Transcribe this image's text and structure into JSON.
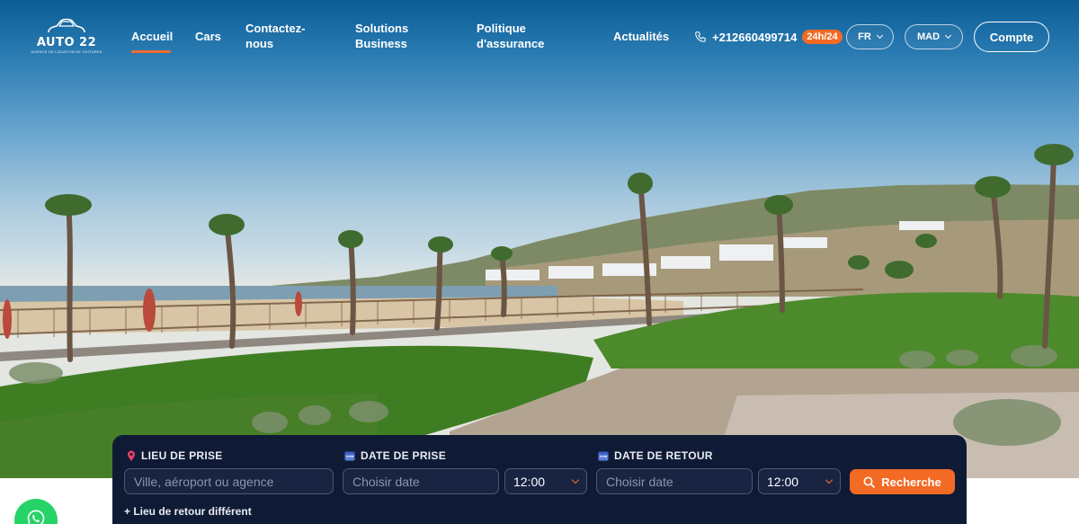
{
  "brand": {
    "name": "AUTO 22",
    "tagline": "AGENCE DE LOCATION DE VOITURES"
  },
  "nav": {
    "items": [
      {
        "label": "Accueil",
        "active": true
      },
      {
        "label": "Cars"
      },
      {
        "label": "Contactez-nous"
      },
      {
        "label": "Solutions Business"
      },
      {
        "label": "Politique d'assurance"
      },
      {
        "label": "Actualités"
      }
    ]
  },
  "contact": {
    "phone": "+212660499714",
    "badge": "24h/24"
  },
  "language": {
    "selected": "FR"
  },
  "currency": {
    "selected": "MAD"
  },
  "account": {
    "label": "Compte"
  },
  "search": {
    "pickup_location": {
      "label": "LIEU DE PRISE",
      "placeholder": "Ville, aéroport ou agence"
    },
    "pickup_date": {
      "label": "DATE DE PRISE",
      "placeholder": "Choisir date",
      "time": "12:00"
    },
    "return_date": {
      "label": "DATE DE RETOUR",
      "placeholder": "Choisir date",
      "time": "12:00"
    },
    "submit_label": "Recherche",
    "different_return": "+ Lieu de retour différent"
  },
  "colors": {
    "accent": "#f26a24",
    "panel": "#0f1b35",
    "whatsapp": "#25d366"
  }
}
